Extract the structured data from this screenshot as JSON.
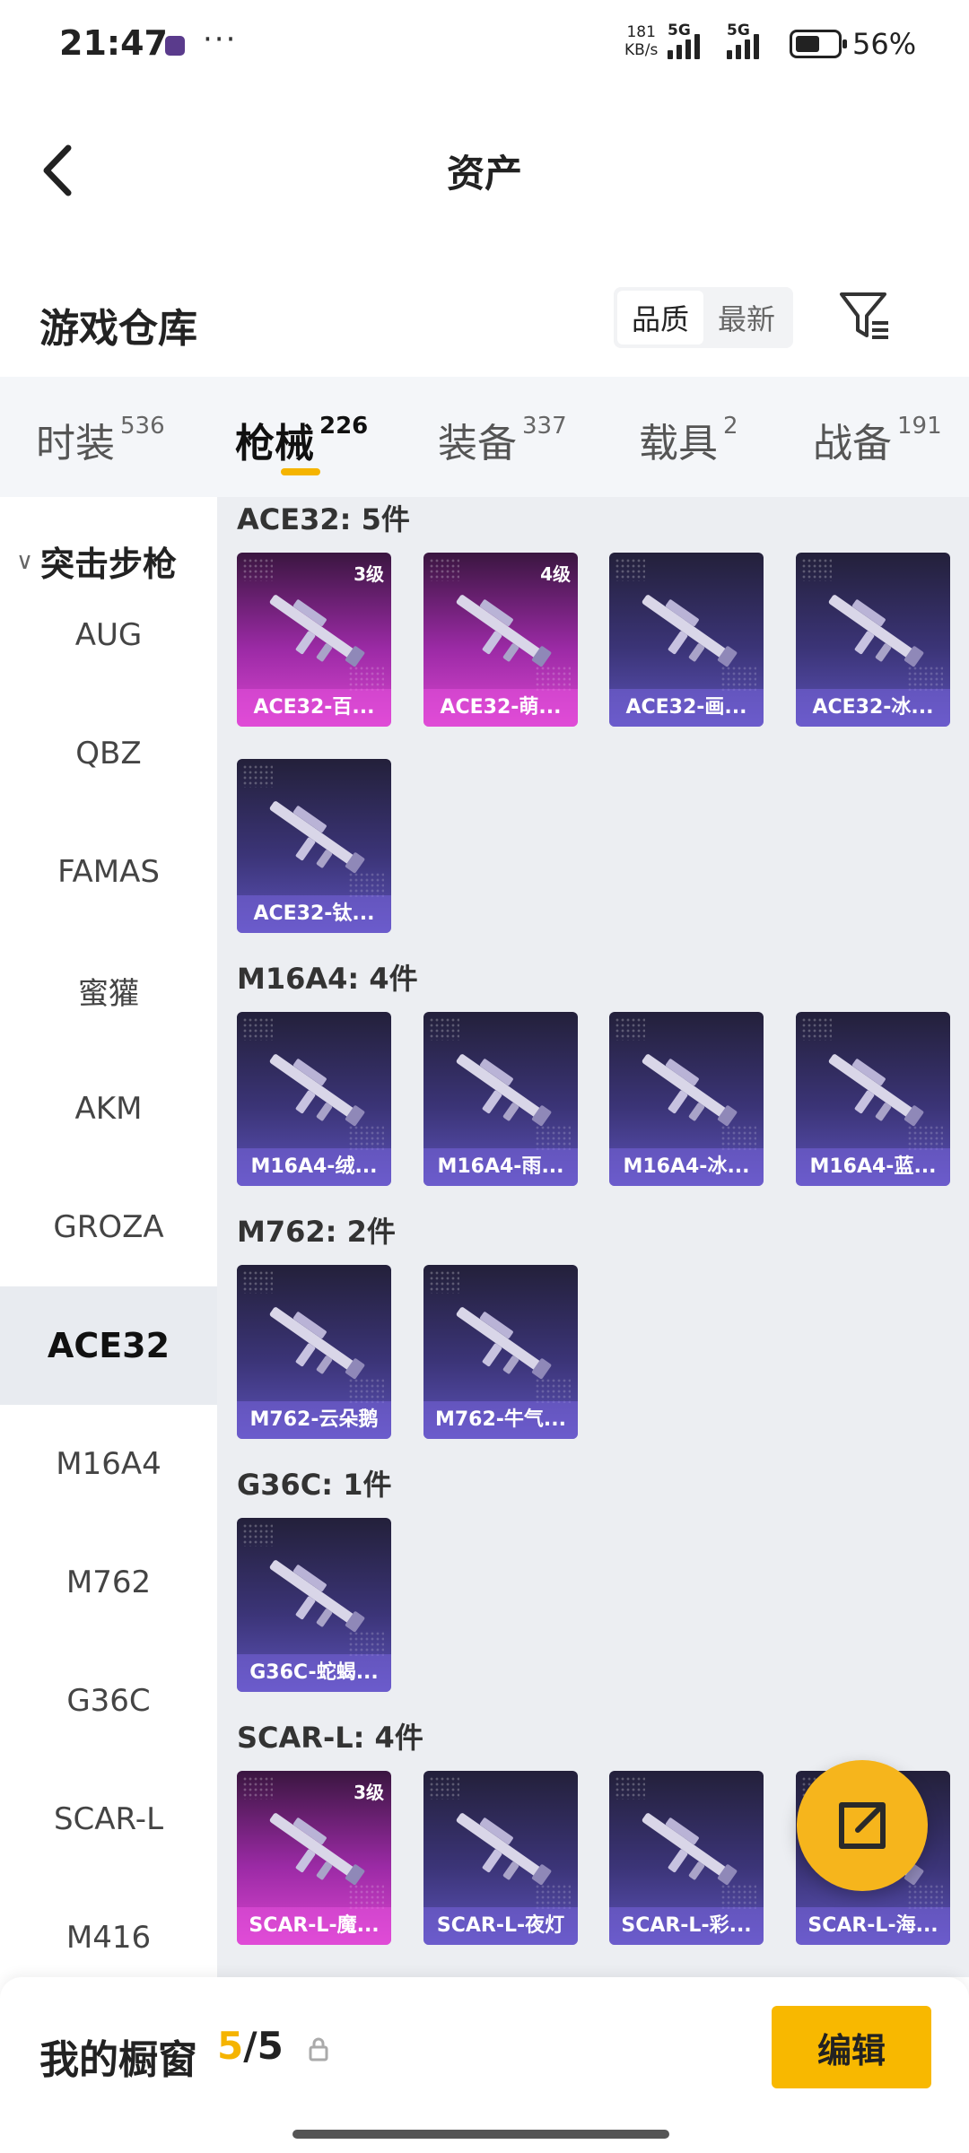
{
  "status_bar": {
    "time": "21:47",
    "more": "···",
    "speed_value": "181",
    "speed_unit": "KB/s",
    "network_1": "5G",
    "network_2": "5G",
    "battery_level_pct": 56,
    "battery_text": "56%"
  },
  "header": {
    "title": "资产",
    "back_icon": "chevron-left-icon"
  },
  "toolbar": {
    "section_title": "游戏仓库",
    "sort_options": [
      "品质",
      "最新"
    ],
    "selected_sort": "品质",
    "filter_icon": "filter-icon"
  },
  "tabs": [
    {
      "name": "时装",
      "count": "536"
    },
    {
      "name": "枪械",
      "count": "226"
    },
    {
      "name": "装备",
      "count": "337"
    },
    {
      "name": "载具",
      "count": "2"
    },
    {
      "name": "战备",
      "count": "191"
    }
  ],
  "active_tab": "枪械",
  "sidebar": {
    "group_label": "突击步枪",
    "items": [
      "AUG",
      "QBZ",
      "FAMAS",
      "蜜獾",
      "AKM",
      "GROZA",
      "ACE32",
      "M16A4",
      "M762",
      "G36C",
      "SCAR-L",
      "M416"
    ],
    "active_item": "ACE32"
  },
  "sections": [
    {
      "title": "ACE32: 5件",
      "items": [
        {
          "label": "ACE32-百...",
          "level": "3级",
          "rarity": "purple"
        },
        {
          "label": "ACE32-萌...",
          "level": "4级",
          "rarity": "purple"
        },
        {
          "label": "ACE32-画...",
          "level": "",
          "rarity": "blue"
        },
        {
          "label": "ACE32-冰...",
          "level": "",
          "rarity": "blue"
        },
        {
          "label": "ACE32-钛...",
          "level": "",
          "rarity": "blue"
        }
      ]
    },
    {
      "title": "M16A4: 4件",
      "items": [
        {
          "label": "M16A4-绒...",
          "level": "",
          "rarity": "blue"
        },
        {
          "label": "M16A4-雨...",
          "level": "",
          "rarity": "blue"
        },
        {
          "label": "M16A4-冰...",
          "level": "",
          "rarity": "blue"
        },
        {
          "label": "M16A4-蓝...",
          "level": "",
          "rarity": "blue"
        }
      ]
    },
    {
      "title": "M762: 2件",
      "items": [
        {
          "label": "M762-云朵鹅",
          "level": "",
          "rarity": "blue"
        },
        {
          "label": "M762-牛气...",
          "level": "",
          "rarity": "blue"
        }
      ]
    },
    {
      "title": "G36C: 1件",
      "items": [
        {
          "label": "G36C-蛇蝎...",
          "level": "",
          "rarity": "blue"
        }
      ]
    },
    {
      "title": "SCAR-L: 4件",
      "items": [
        {
          "label": "SCAR-L-魔...",
          "level": "3级",
          "rarity": "purple"
        },
        {
          "label": "SCAR-L-夜灯",
          "level": "",
          "rarity": "blue"
        },
        {
          "label": "SCAR-L-彩...",
          "level": "",
          "rarity": "blue"
        },
        {
          "label": "SCAR-L-海...",
          "level": "",
          "rarity": "blue"
        }
      ]
    }
  ],
  "fab": {
    "icon": "share-icon"
  },
  "bottom_bar": {
    "label": "我的橱窗",
    "current": "5",
    "separator": "/",
    "max": "5",
    "lock_icon": "lock-icon",
    "edit_label": "编辑"
  },
  "colors": {
    "accent": "#f5b400",
    "card_blue": "#3b3477",
    "card_purple": "#9b2aa5"
  }
}
